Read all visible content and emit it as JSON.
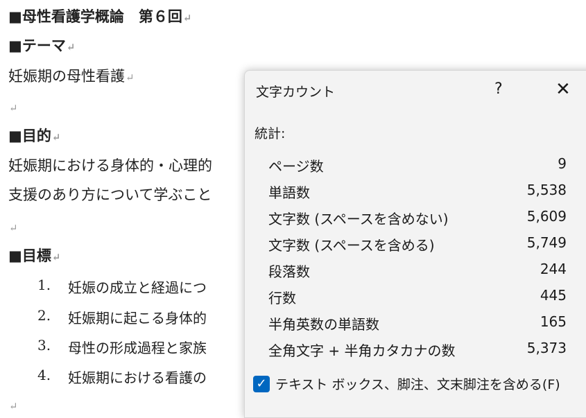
{
  "document": {
    "heading_title": "■母性看護学概論　第６回",
    "heading_theme": "■テーマ",
    "theme_text": "妊娠期の母性看護",
    "heading_purpose": "■目的",
    "purpose_line1": "妊娠期における身体的・心理的",
    "purpose_line2": "支援のあり方について学ぶこと",
    "heading_goals": "■目標",
    "goals": [
      {
        "num": "1.",
        "text": "妊娠の成立と経過につ"
      },
      {
        "num": "2.",
        "text": "妊娠期に起こる身体的"
      },
      {
        "num": "3.",
        "text": "母性の形成過程と家族"
      },
      {
        "num": "4.",
        "text": "妊娠期における看護の"
      }
    ],
    "paragraph_mark": "↵"
  },
  "dialog": {
    "title": "文字カウント",
    "help_label": "?",
    "close_label": "✕",
    "section_label": "統計:",
    "stats": [
      {
        "label": "ページ数",
        "value": "9"
      },
      {
        "label": "単語数",
        "value": "5,538"
      },
      {
        "label": "文字数 (スペースを含めない)",
        "value": "5,609"
      },
      {
        "label": "文字数 (スペースを含める)",
        "value": "5,749"
      },
      {
        "label": "段落数",
        "value": "244"
      },
      {
        "label": "行数",
        "value": "445"
      },
      {
        "label": "半角英数の単語数",
        "value": "165"
      },
      {
        "label": "全角文字 + 半角カタカナの数",
        "value": "5,373"
      }
    ],
    "checkbox_label": "テキスト ボックス、脚注、文末脚注を含める(F)",
    "checkbox_checked": true,
    "checkbox_mark": "✓"
  }
}
